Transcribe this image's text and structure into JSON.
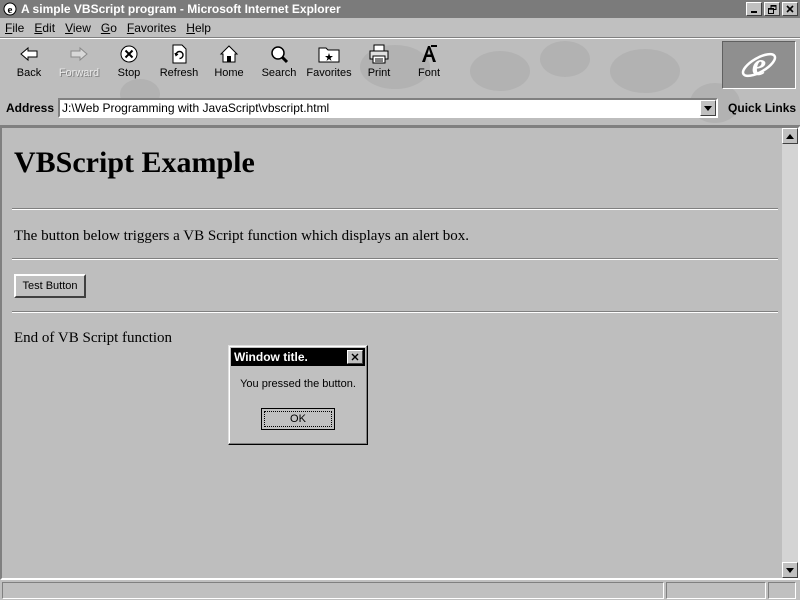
{
  "window": {
    "title": "A simple VBScript program - Microsoft Internet Explorer",
    "icons": [
      "ie-app-icon",
      "minimize-icon",
      "restore-icon",
      "close-icon"
    ]
  },
  "menu": {
    "items": [
      {
        "key": "F",
        "rest": "ile"
      },
      {
        "key": "E",
        "rest": "dit"
      },
      {
        "key": "V",
        "rest": "iew"
      },
      {
        "key": "G",
        "rest": "o"
      },
      {
        "key": "F",
        "rest": "avorites"
      },
      {
        "key": "H",
        "rest": "elp"
      }
    ]
  },
  "toolbar": {
    "back": "Back",
    "forward": "Forward",
    "stop": "Stop",
    "refresh": "Refresh",
    "home": "Home",
    "search": "Search",
    "favorites": "Favorites",
    "print": "Print",
    "font": "Font"
  },
  "address": {
    "label": "Address",
    "value": "J:\\Web Programming with JavaScript\\vbscript.html",
    "quick_links": "Quick Links"
  },
  "page": {
    "heading": "VBScript Example",
    "paragraph": "The button below triggers a VB Script function which displays an alert box.",
    "button_label": "Test Button",
    "end_text": "End of VB Script function"
  },
  "dialog": {
    "title": "Window title.",
    "message": "You pressed the button.",
    "ok_label": "OK"
  }
}
